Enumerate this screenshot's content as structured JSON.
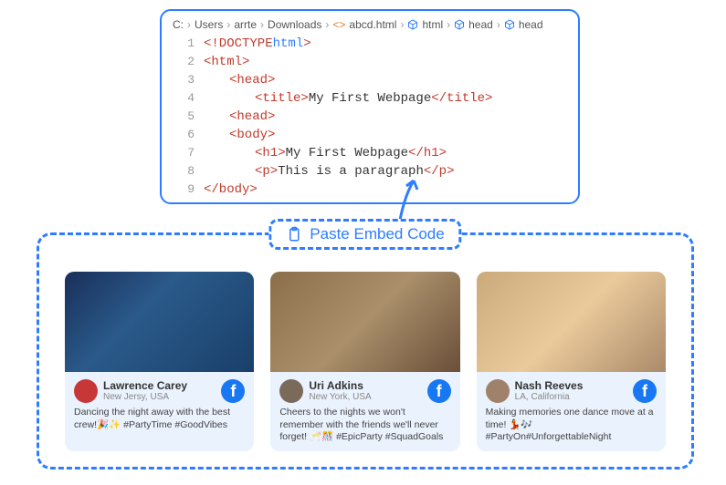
{
  "breadcrumbs": [
    "C:",
    "Users",
    "arrte",
    "Downloads",
    "abcd.html",
    "html",
    "head",
    "head"
  ],
  "code": {
    "l1a": "<!DOCTYPE ",
    "l1b": "html",
    "l1c": ">",
    "l2": "<html>",
    "l3": "<head>",
    "l4a": "<title>",
    "l4b": "My First Webpage",
    "l4c": "</title>",
    "l5": "<head>",
    "l6": "<body>",
    "l7a": "<h1>",
    "l7b": "My First Webpage",
    "l7c": "</h1>",
    "l8a": "<p>",
    "l8b": "This is a paragraph",
    "l8c": "</p>",
    "l9": "</body>"
  },
  "nums": {
    "1": "1",
    "2": "2",
    "3": "3",
    "4": "4",
    "5": "5",
    "6": "6",
    "7": "7",
    "8": "8",
    "9": "9"
  },
  "embed_label": "Paste Embed Code",
  "cards": [
    {
      "name": "Lawrence Carey",
      "loc": "New Jersy, USA",
      "post": "Dancing the night away with the best crew!🎉✨ #PartyTime #GoodVibes"
    },
    {
      "name": "Uri Adkins",
      "loc": "New York, USA",
      "post": "Cheers to the nights we won't remember with the friends we'll never forget! 🥂🎊 #EpicParty #SquadGoals"
    },
    {
      "name": "Nash Reeves",
      "loc": "LA, California",
      "post": "Making memories one dance move at a time! 💃🎶 #PartyOn#UnforgettableNight"
    }
  ]
}
